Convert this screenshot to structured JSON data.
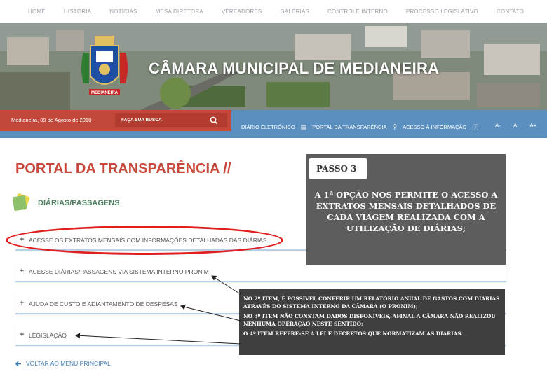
{
  "nav": {
    "items": [
      "HOME",
      "HISTÓRIA",
      "NOTÍCIAS",
      "MESA DIRETORA",
      "VEREADORES",
      "GALERIAS",
      "CONTROLE INTERNO",
      "PROCESSO LEGISLATIVO",
      "CONTATO"
    ]
  },
  "banner": {
    "title": "CÂMARA MUNICIPAL DE MEDIANEIRA",
    "crest_label": "MEDIANEIRA"
  },
  "infobar": {
    "date": "Medianeira, 09 de Agosto de 2018",
    "search_placeholder": "FAÇA SUA BUSCA",
    "links": [
      "DIÁRIO ELETRÔNICO",
      "PORTAL DA TRANSPARÊNCIA",
      "ACESSO À INFORMAÇÃO"
    ],
    "font_sizes": [
      "A-",
      "A",
      "A+"
    ]
  },
  "main": {
    "page_title": "PORTAL DA TRANSPARÊNCIA //",
    "section_title": "DIÁRIAS/PASSAGENS",
    "accordion": [
      "ACESSE OS EXTRATOS MENSAIS COM INFORMAÇÕES DETALHADAS DAS DIÁRIAS",
      "ACESSE DIÁRIAS/PASSAGENS VIA SISTEMA INTERNO PRONIM",
      "AJUDA DE CUSTO E ADIANTAMENTO DE DESPESAS",
      "LEGISLAÇÃO"
    ],
    "back_link": "VOLTAR AO MENU PRINCIPAL"
  },
  "callout": {
    "tag": "PASSO 3",
    "text": "A 1ª OPÇÃO NOS PERMITE O ACESSO A EXTRATOS MENSAIS DETALHADOS DE CADA VIAGEM REALIZADA COM A UTILIZAÇÃO DE DIÁRIAS;"
  },
  "annotation": {
    "lines": [
      "NO 2º ITEM, É POSSÍVEL CONFERIR UM RELATÓRIO ANUAL DE GASTOS COM DIÁRIAS ATRAVÉS DO SISTEMA INTERNO DA CÂMARA (O PRONIM);",
      "NO 3º ITEM NÃO CONSTAM DADOS DISPONÍVEIS, AFINAL A CÂMARA NÃO REALIZOU NENHUMA OPERAÇÃO NESTE SENTIDO;",
      "O 4º ITEM REFERE-SE A LEI E DECRETOS QUE NORMATIZAM AS DIÁRIAS."
    ]
  },
  "colors": {
    "brand_red": "#c8483b",
    "info_blue": "#5a8fbf",
    "link_blue": "#3d7fbf",
    "section_green": "#4e8060",
    "highlight_red": "#e01f1f"
  }
}
